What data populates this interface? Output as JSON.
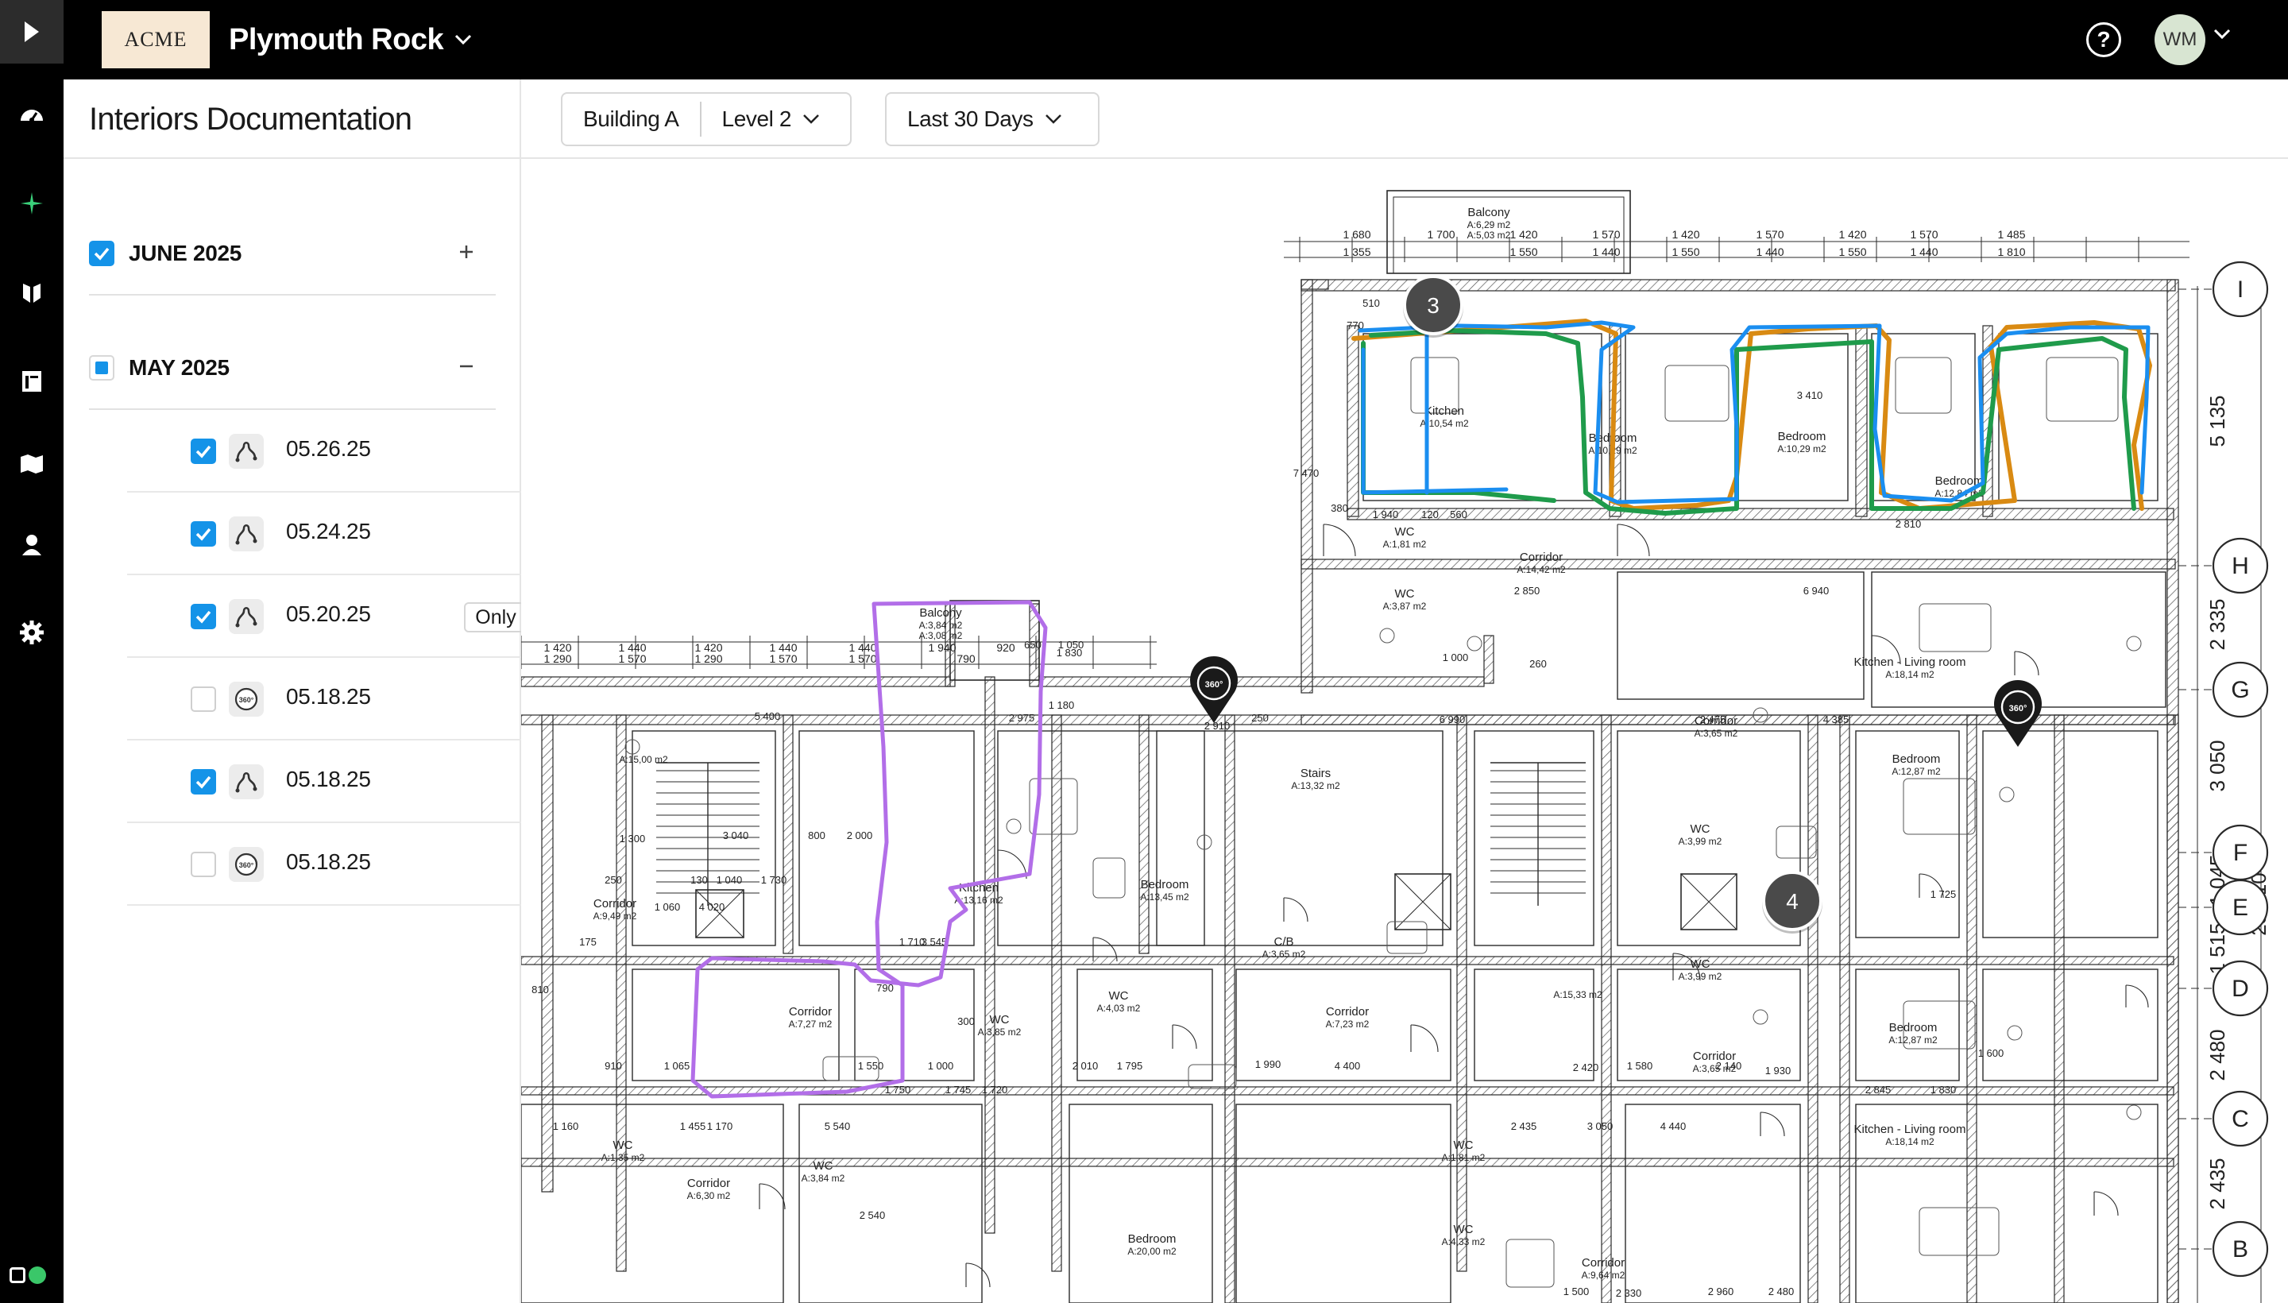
{
  "brand": {
    "logo_text": "ACME"
  },
  "project": {
    "name": "Plymouth Rock"
  },
  "user": {
    "initials": "WM"
  },
  "panel": {
    "title": "Interiors Documentation",
    "groups": [
      {
        "label": "JUNE 2025",
        "state": "checked",
        "action": "+"
      },
      {
        "label": "MAY 2025",
        "state": "mixed",
        "action": "−"
      }
    ],
    "captures": [
      {
        "date": "05.26.25",
        "checked": true,
        "kind": "walk-path-icon",
        "color": "#1a8ef0"
      },
      {
        "date": "05.24.25",
        "checked": true,
        "kind": "walk-path-icon",
        "color": "#1f9b4b"
      },
      {
        "date": "05.20.25",
        "checked": true,
        "kind": "walk-path-icon",
        "color": "#d98a12",
        "only_label": "Only"
      },
      {
        "date": "05.18.25",
        "checked": false,
        "kind": "360-camera-icon",
        "color": ""
      },
      {
        "date": "05.18.25",
        "checked": true,
        "kind": "walk-path-icon",
        "color": "#b26ee8"
      },
      {
        "date": "05.18.25",
        "checked": false,
        "kind": "360-camera-icon",
        "color": ""
      }
    ]
  },
  "filters": {
    "building": "Building A",
    "level": "Level 2",
    "range": "Last 30 Days"
  },
  "plan": {
    "grid_lines": [
      "I",
      "H",
      "G",
      "F",
      "E",
      "D",
      "C",
      "B"
    ],
    "pins": [
      "3",
      "4"
    ],
    "pin_360_label": "360°",
    "rooms": [
      {
        "name": "Balcony",
        "area": "A:6,29 m2",
        "area2": "A:5,03 m2"
      },
      {
        "name": "Kitchen",
        "area": "A:10,54 m2"
      },
      {
        "name": "Bedroom",
        "area": "A:10,29 m2"
      },
      {
        "name": "Bedroom",
        "area": "A:10,29 m2"
      },
      {
        "name": "Bedroom",
        "area": "A:12,84 m2"
      },
      {
        "name": "Corridor",
        "area": "A:14,42 m2"
      },
      {
        "name": "WC",
        "area": "A:1,81 m2"
      },
      {
        "name": "WC",
        "area": "A:3,87 m2"
      },
      {
        "name": "Kitchen - Living room",
        "area": "A:18,14 m2"
      },
      {
        "name": "Balcony",
        "area": "A:3,84 m2",
        "area2": "A:3,08 m2"
      },
      {
        "name": "Kitchen",
        "area": "A:13,16 m2"
      },
      {
        "name": "Stairs",
        "area": "A:13,32 m2"
      },
      {
        "name": "Bedroom",
        "area": "A:13,45 m2"
      },
      {
        "name": "Corridor",
        "area": "A:9,49 m2"
      },
      {
        "name": "Corridor",
        "area": "A:7,27 m2"
      },
      {
        "name": "WC",
        "area": "A:3,85 m2"
      },
      {
        "name": "WC",
        "area": "A:4,03 m2"
      },
      {
        "name": "C/B",
        "area": "A:3,65 m2"
      },
      {
        "name": "Corridor",
        "area": "A:7,23 m2"
      },
      {
        "name": "Corridor",
        "area": "A:3,65 m2"
      },
      {
        "name": "WC",
        "area": "A:3,99 m2"
      },
      {
        "name": "Bedroom",
        "area": "A:12,87 m2"
      },
      {
        "name": "Bedroom",
        "area": "A:12,87 m2"
      },
      {
        "name": "WC",
        "area": "A:3,99 m2"
      },
      {
        "name": "Corridor",
        "area": "A:3,65 m2"
      },
      {
        "name": "Kitchen - Living room",
        "area": "A:18,14 m2"
      },
      {
        "name": "WC",
        "area": "A:1,35 m2"
      },
      {
        "name": "Corridor",
        "area": "A:6,30 m2"
      },
      {
        "name": "WC",
        "area": "A:3,84 m2"
      },
      {
        "name": "WC",
        "area": "A:1,81 m2"
      },
      {
        "name": "WC",
        "area": "A:4,33 m2"
      },
      {
        "name": "Bedroom",
        "area": "A:20,00 m2"
      },
      {
        "name": "Corridor",
        "area": "A:9,64 m2"
      }
    ],
    "room_area_only": [
      "A:15,00 m2",
      "A:15,33 m2"
    ],
    "dimensions_top": [
      "1 680",
      "1 355",
      "1 700",
      "1 550",
      "1 420",
      "1 440",
      "1 570",
      "1 550",
      "1 420",
      "1 440",
      "1 570",
      "1 550",
      "1 420",
      "1 440",
      "1 570",
      "1 810",
      "1 485"
    ],
    "dimensions_left_row": [
      "1 420",
      "1 290",
      "1 440",
      "1 570",
      "1 420",
      "1 290",
      "1 440",
      "1 570",
      "1 440",
      "1 570",
      "1 940",
      "790",
      "920"
    ],
    "dimensions_misc": [
      "510",
      "770",
      "7 470",
      "380",
      "1 940",
      "120",
      "560",
      "2 850",
      "6 940",
      "650",
      "1 050",
      "1 830",
      "1 180",
      "2 975",
      "5 400",
      "2 910",
      "250",
      "6 990",
      "2 475",
      "4 385",
      "3 410",
      "2 810",
      "1 000",
      "260",
      "1 300",
      "3 040",
      "800",
      "2 000",
      "1 040",
      "1 730",
      "130",
      "250",
      "1 060",
      "4 020",
      "175",
      "810",
      "1 710",
      "3 545",
      "790",
      "300",
      "1 550",
      "1 000",
      "910",
      "1 065",
      "1 750",
      "1 745",
      "1 720",
      "2 010",
      "1 795",
      "1 990",
      "4 400",
      "2 420",
      "1 580",
      "2 140",
      "1 930",
      "2 845",
      "1 830",
      "1 725",
      "1 600",
      "1 455",
      "1 160",
      "1 170",
      "5 540",
      "2 435",
      "3 050",
      "4 440",
      "2 540",
      "1 500",
      "2 330",
      "2 960",
      "2 480"
    ],
    "dimensions_right": [
      "5 135",
      "2 335",
      "3 050",
      "1 045",
      "1 515",
      "2 480",
      "2 435",
      "23 010"
    ]
  }
}
